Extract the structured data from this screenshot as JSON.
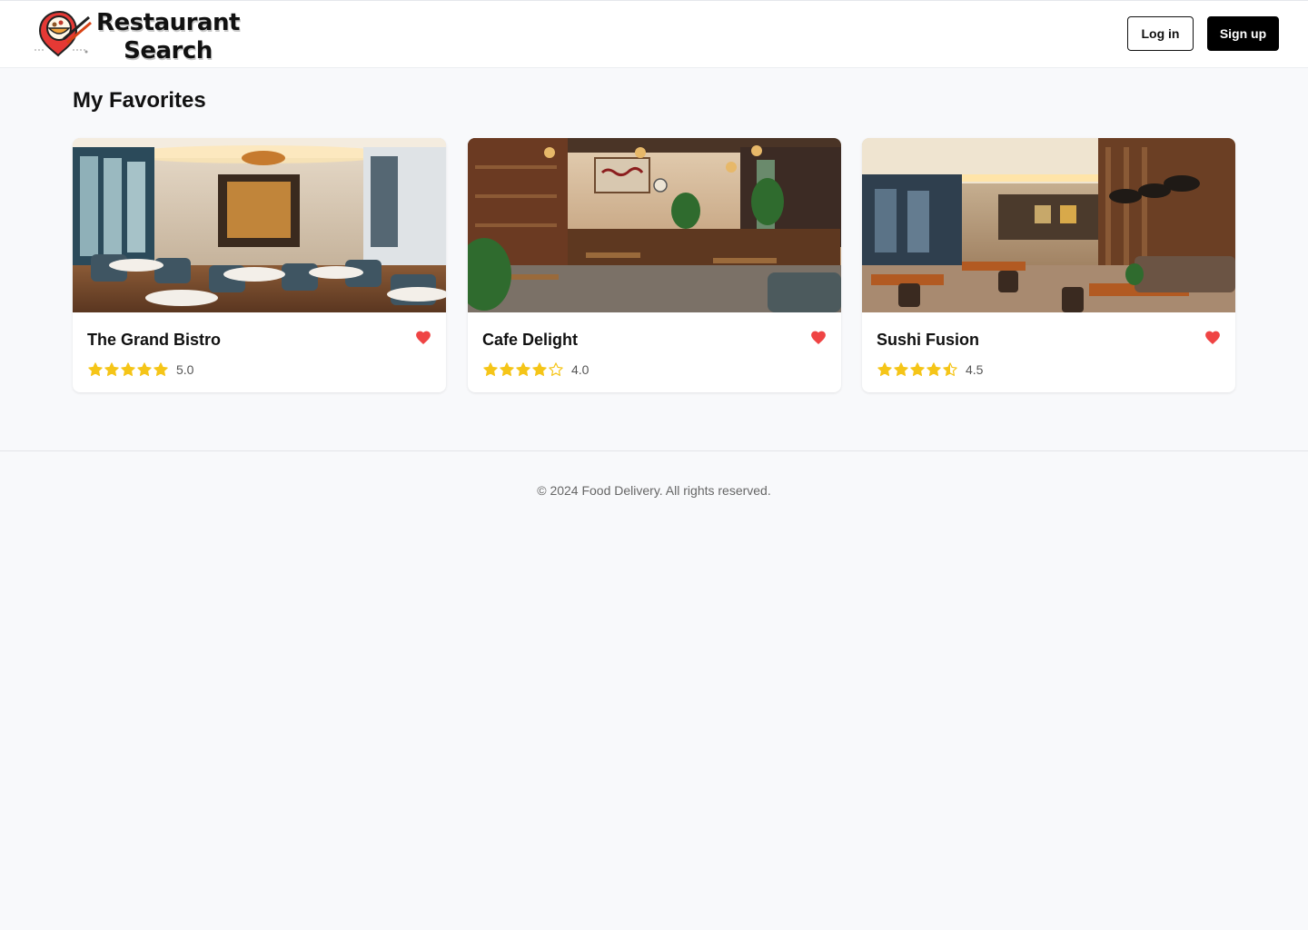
{
  "app": {
    "logo_line1": "Restaurant",
    "logo_line2": "Search",
    "logo_icon": "chopsticks-bowl-pin-icon"
  },
  "header": {
    "login_label": "Log in",
    "signup_label": "Sign up"
  },
  "main": {
    "title": "My Favorites",
    "favorites": [
      {
        "name": "The Grand Bistro",
        "rating": 5.0,
        "rating_label": "5.0",
        "favorited": true,
        "image": "restaurant-interior-photo"
      },
      {
        "name": "Cafe Delight",
        "rating": 4.0,
        "rating_label": "4.0",
        "favorited": true,
        "image": "cafe-interior-photo"
      },
      {
        "name": "Sushi Fusion",
        "rating": 4.5,
        "rating_label": "4.5",
        "favorited": true,
        "image": "restaurant-interior-photo"
      }
    ]
  },
  "footer": {
    "copyright": "© 2024 Food Delivery. All rights reserved."
  },
  "colors": {
    "star": "#f5c518",
    "heart": "#ef4444",
    "primary_button": "#000000",
    "page_background": "#f8f9fb"
  }
}
